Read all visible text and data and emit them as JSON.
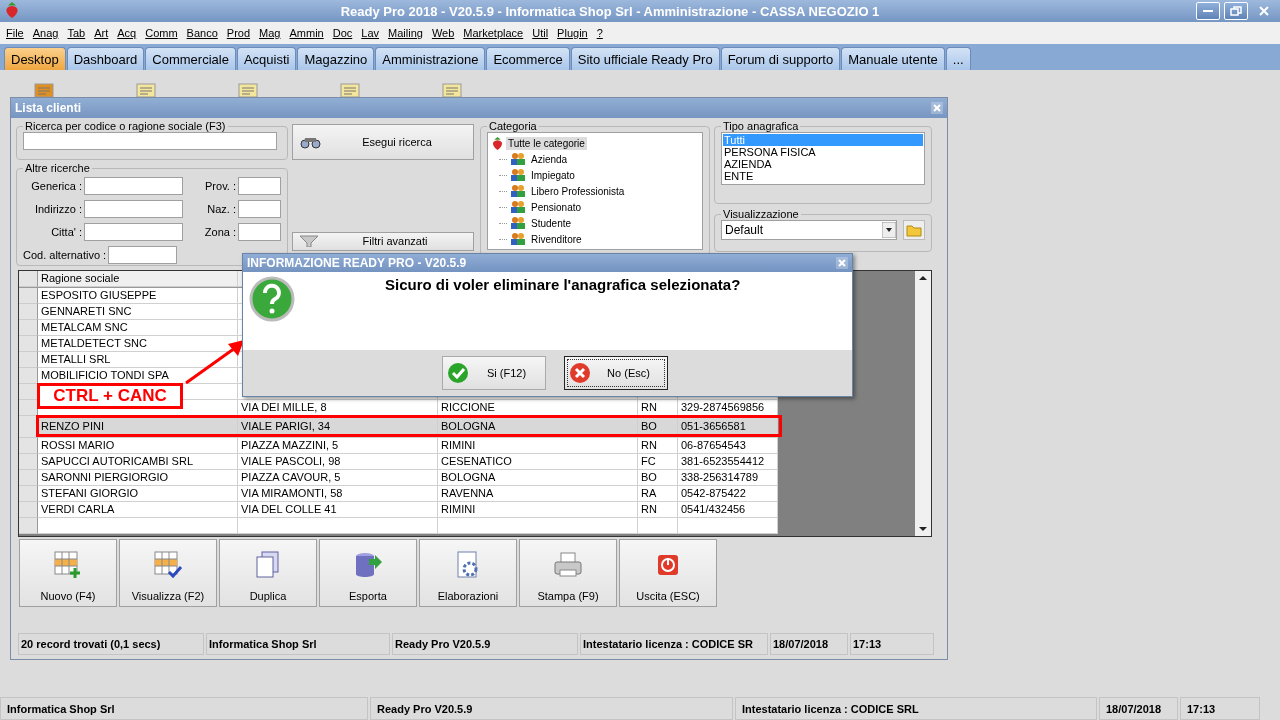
{
  "window": {
    "title": "Ready Pro 2018 - V20.5.9 - Informatica Shop Srl - Amministrazione - CASSA NEGOZIO 1"
  },
  "menu": [
    "File",
    "Anag",
    "Tab",
    "Art",
    "Acq",
    "Comm",
    "Banco",
    "Prod",
    "Mag",
    "Ammin",
    "Doc",
    "Lav",
    "Mailing",
    "Web",
    "Marketplace",
    "Util",
    "Plugin",
    "?"
  ],
  "tabs": [
    {
      "label": "Desktop",
      "selected": true
    },
    {
      "label": "Dashboard",
      "selected": false
    },
    {
      "label": "Commerciale",
      "selected": false
    },
    {
      "label": "Acquisti",
      "selected": false
    },
    {
      "label": "Magazzino",
      "selected": false
    },
    {
      "label": "Amministrazione",
      "selected": false
    },
    {
      "label": "Ecommerce",
      "selected": false
    },
    {
      "label": "Sito ufficiale Ready Pro",
      "selected": false
    },
    {
      "label": "Forum di supporto",
      "selected": false
    },
    {
      "label": "Manuale utente",
      "selected": false
    },
    {
      "label": "...",
      "selected": false
    }
  ],
  "client_list": {
    "title": "Lista clienti",
    "search": {
      "legend": "Ricerca per codice o ragione sociale (F3)"
    },
    "other_searches": {
      "legend": "Altre ricerche",
      "left_fields": [
        "Generica :",
        "Indirizzo :",
        "Citta' :"
      ],
      "right_fields": [
        "Prov. :",
        "Naz. :",
        "Zona :"
      ],
      "alt_code": "Cod. alternativo :"
    },
    "search_button": "Esegui ricerca",
    "filters_button": "Filtri avanzati",
    "category": {
      "legend": "Categoria",
      "root": {
        "label": "Tutte le categorie",
        "selected": true,
        "children": [
          {
            "label": "Azienda",
            "selected": false
          },
          {
            "label": "Impiegato",
            "selected": false
          },
          {
            "label": "Libero Professionista",
            "selected": false
          },
          {
            "label": "Pensionato",
            "selected": false
          },
          {
            "label": "Studente",
            "selected": false
          },
          {
            "label": "Rivenditore",
            "selected": false
          }
        ]
      }
    },
    "type": {
      "legend": "Tipo anagrafica",
      "options": [
        {
          "label": "Tutti",
          "selected": true
        },
        {
          "label": "PERSONA FISICA",
          "selected": false
        },
        {
          "label": "AZIENDA",
          "selected": false
        },
        {
          "label": "ENTE",
          "selected": false
        }
      ]
    },
    "view": {
      "legend": "Visualizzazione",
      "value": "Default"
    },
    "table": {
      "columns": [
        "Ragione sociale"
      ],
      "rows": [
        {
          "ragione_sociale": "ESPOSITO GIUSEPPE",
          "selected": false
        },
        {
          "ragione_sociale": "GENNARETI SNC",
          "selected": false
        },
        {
          "ragione_sociale": "METALCAM SNC",
          "selected": false
        },
        {
          "ragione_sociale": "METALDETECT SNC",
          "selected": false
        },
        {
          "ragione_sociale": "METALLI SRL",
          "selected": false
        },
        {
          "ragione_sociale": "MOBILIFICIO TONDI SPA",
          "selected": false
        },
        {
          "selected": false
        },
        {
          "column_2": "VIA DEI MILLE, 8",
          "column_3": "RICCIONE",
          "column_4": "RN",
          "column_5": "329-2874569856",
          "selected": false
        },
        {
          "ragione_sociale": "RENZO PINI",
          "column_2": "VIALE PARIGI, 34",
          "column_3": "BOLOGNA",
          "column_4": "BO",
          "column_5": "051-3656581",
          "selected": true
        },
        {
          "ragione_sociale": "ROSSI MARIO",
          "column_2": "PIAZZA MAZZINI, 5",
          "column_3": "RIMINI",
          "column_4": "RN",
          "column_5": "06-87654543",
          "selected": false
        },
        {
          "ragione_sociale": "SAPUCCI AUTORICAMBI SRL",
          "column_2": "VIALE PASCOLI, 98",
          "column_3": "CESENATICO",
          "column_4": "FC",
          "column_5": "381-6523554412",
          "selected": false
        },
        {
          "ragione_sociale": "SARONNI PIERGIORGIO",
          "column_2": "PIAZZA CAVOUR, 5",
          "column_3": "BOLOGNA",
          "column_4": "BO",
          "column_5": "338-256314789",
          "selected": false
        },
        {
          "ragione_sociale": "STEFANI GIORGIO",
          "column_2": "VIA MIRAMONTI, 58",
          "column_3": "RAVENNA",
          "column_4": "RA",
          "column_5": "0542-875422",
          "selected": false
        },
        {
          "ragione_sociale": "VERDI CARLA",
          "column_2": "VIA DEL COLLE 41",
          "column_3": "RIMINI",
          "column_4": "RN",
          "column_5": "0541/432456",
          "selected": false
        },
        {
          "selected": false
        }
      ]
    },
    "toolbar": [
      {
        "label": "Nuovo (F4)",
        "kind": "new"
      },
      {
        "label": "Visualizza (F2)",
        "kind": "view"
      },
      {
        "label": "Duplica",
        "kind": "duplicate"
      },
      {
        "label": "Esporta",
        "kind": "export"
      },
      {
        "label": "Elaborazioni",
        "kind": "process"
      },
      {
        "label": "Stampa (F9)",
        "kind": "print"
      },
      {
        "label": "Uscita (ESC)",
        "kind": "exit"
      }
    ],
    "status_bar": [
      "20 record trovati (0,1 secs)",
      "Informatica Shop Srl",
      "Ready Pro V20.5.9",
      "Intestatario licenza : CODICE SR",
      "18/07/2018",
      "17:13"
    ]
  },
  "dialog": {
    "title": "INFORMAZIONE READY PRO - V20.5.9",
    "message": "Sicuro di voler eliminare l'anagrafica selezionata?",
    "buttons": [
      {
        "label": "Si (F12)",
        "kind": "yes",
        "focused": false
      },
      {
        "label": "No (Esc)",
        "kind": "no",
        "focused": true
      }
    ]
  },
  "annotation": {
    "label": "CTRL + CANC"
  },
  "status_bar": [
    "Informatica Shop Srl",
    "Ready Pro V20.5.9",
    "Intestatario licenza : CODICE SRL",
    "18/07/2018",
    "17:13"
  ]
}
